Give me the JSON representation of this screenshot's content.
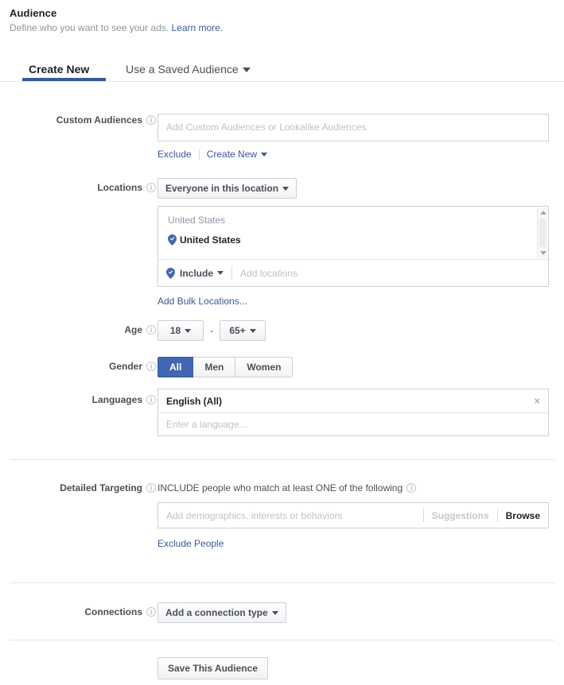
{
  "header": {
    "title": "Audience",
    "subtitle": "Define who you want to see your ads.",
    "learn_more": "Learn more."
  },
  "tabs": {
    "create_new": "Create New",
    "saved_audience": "Use a Saved Audience",
    "active": "Create New",
    "underline_color": "#3b5998"
  },
  "custom_audiences": {
    "label": "Custom Audiences",
    "placeholder": "Add Custom Audiences or Lookalike Audiences",
    "value": "",
    "exclude_link": "Exclude",
    "create_new_link": "Create New"
  },
  "locations": {
    "label": "Locations",
    "scope_button": "Everyone in this location",
    "group_header": "United States",
    "selected": [
      {
        "name": "United States",
        "icon": "location-pin-icon"
      }
    ],
    "include_mode": "Include",
    "add_placeholder": "Add locations",
    "bulk_link": "Add Bulk Locations...",
    "scrollbar": {
      "up": "scroll-up-arrow",
      "down": "scroll-down-arrow"
    }
  },
  "age": {
    "label": "Age",
    "min": "18",
    "max": "65+",
    "separator": "-"
  },
  "gender": {
    "label": "Gender",
    "options": [
      "All",
      "Men",
      "Women"
    ],
    "selected": "All",
    "selected_color": "#4267b2"
  },
  "languages": {
    "label": "Languages",
    "selected": "English (All)",
    "remove_icon": "×",
    "placeholder": "Enter a language..."
  },
  "detailed_targeting": {
    "label": "Detailed Targeting",
    "include_text": "INCLUDE people who match at least ONE of the following",
    "placeholder": "Add demographics, interests or behaviors",
    "suggestions": "Suggestions",
    "browse": "Browse",
    "exclude_link": "Exclude People"
  },
  "connections": {
    "label": "Connections",
    "button": "Add a connection type"
  },
  "footer": {
    "save_button": "Save This Audience"
  }
}
